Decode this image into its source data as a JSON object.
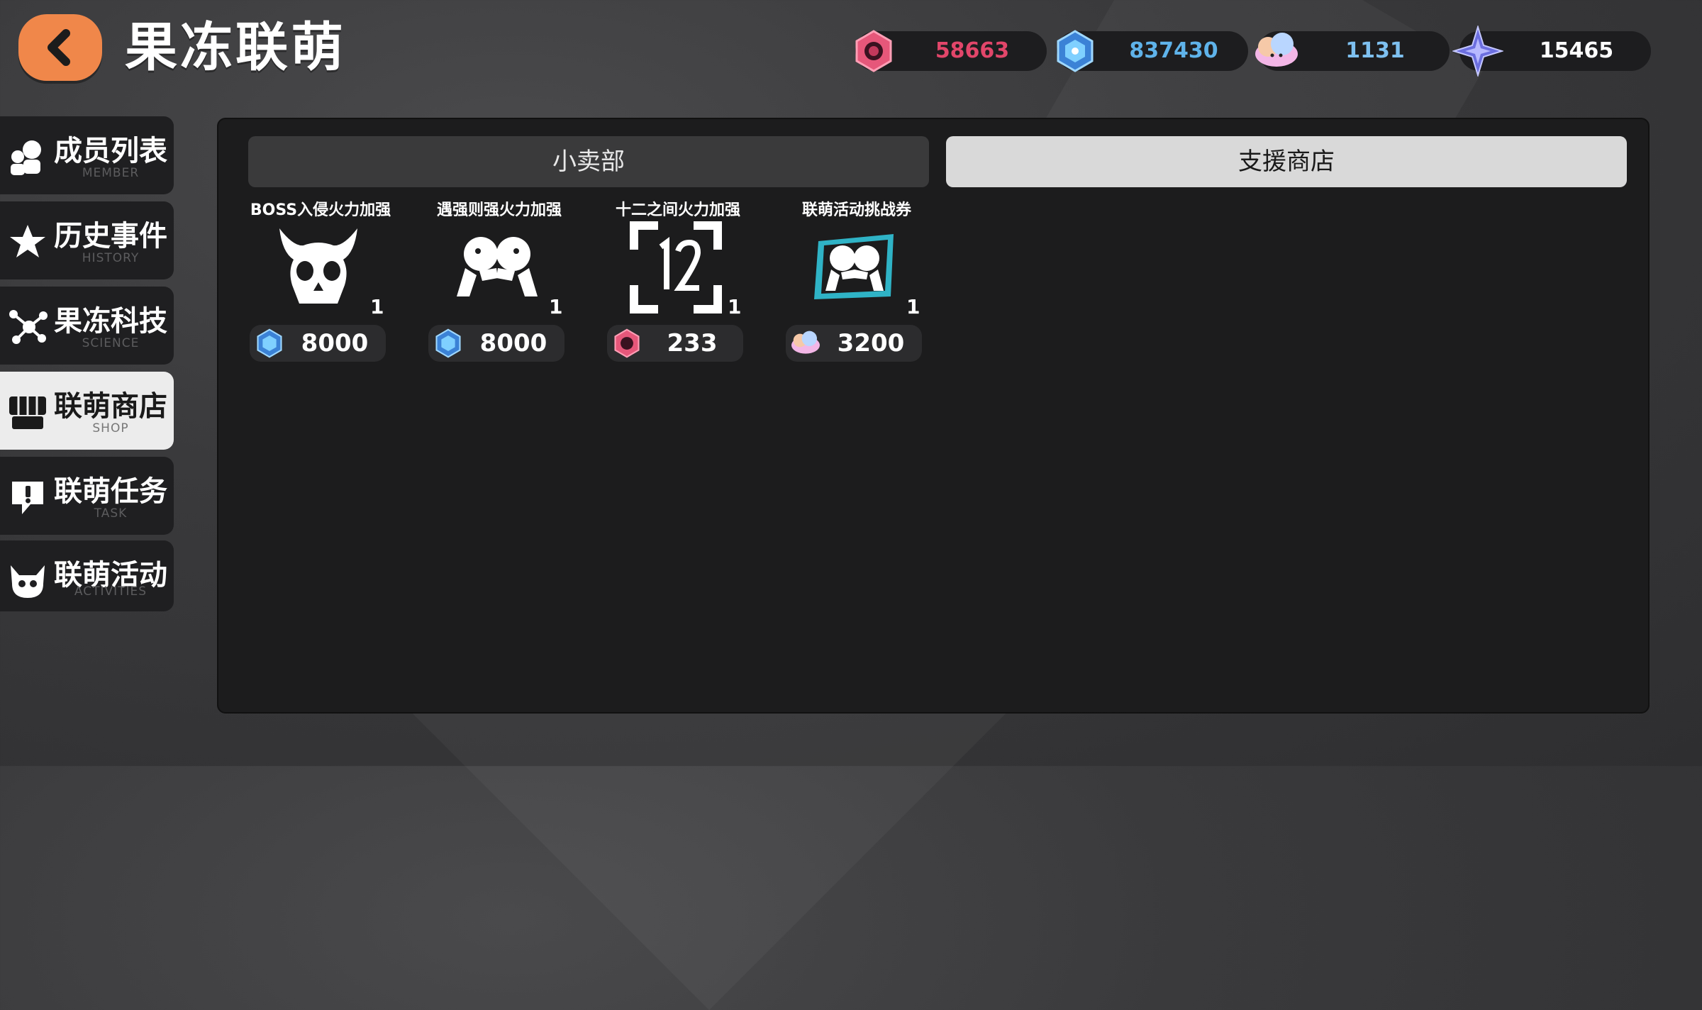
{
  "header": {
    "title": "果冻联萌",
    "back_icon": "chevron-left-icon"
  },
  "currencies": [
    {
      "name": "red-hex-gem-icon",
      "value": "58663",
      "color": "#e2466a"
    },
    {
      "name": "blue-crystal-cube-icon",
      "value": "837430",
      "color": "#5fb3ea"
    },
    {
      "name": "rainbow-cloud-icon",
      "value": "1131",
      "color": "#7ec0f0"
    },
    {
      "name": "star-shuriken-icon",
      "value": "15465",
      "color": "#ffffff"
    }
  ],
  "sidebar": {
    "items": [
      {
        "label": "成员列表",
        "sub": "MEMBER",
        "icon": "members-icon"
      },
      {
        "label": "历史事件",
        "sub": "HISTORY",
        "icon": "star-icon"
      },
      {
        "label": "果冻科技",
        "sub": "SCIENCE",
        "icon": "network-icon"
      },
      {
        "label": "联萌商店",
        "sub": "SHOP",
        "icon": "shop-icon"
      },
      {
        "label": "联萌任务",
        "sub": "TASK",
        "icon": "exclamation-bubble-icon"
      },
      {
        "label": "联萌活动",
        "sub": "ACTIVITIES",
        "icon": "horned-face-icon"
      }
    ],
    "active": "联萌商店"
  },
  "tabs": {
    "left": "小卖部",
    "right": "支援商店",
    "selected": "支援商店"
  },
  "shop_items": [
    {
      "name": "BOSS入侵火力加强",
      "icon": "horned-skull-icon",
      "count": "1",
      "price": "8000",
      "currency_icon": "blue-crystal-cube-icon"
    },
    {
      "name": "遇强则强火力加强",
      "icon": "fist-bump-icon",
      "count": "1",
      "price": "8000",
      "currency_icon": "blue-crystal-cube-icon"
    },
    {
      "name": "十二之间火力加强",
      "icon": "twelve-frame-icon",
      "count": "1",
      "price": "233",
      "currency_icon": "red-hex-gem-icon"
    },
    {
      "name": "联萌活动挑战券",
      "icon": "fist-bump-ticket-icon",
      "count": "1",
      "price": "3200",
      "currency_icon": "rainbow-cloud-icon"
    }
  ]
}
